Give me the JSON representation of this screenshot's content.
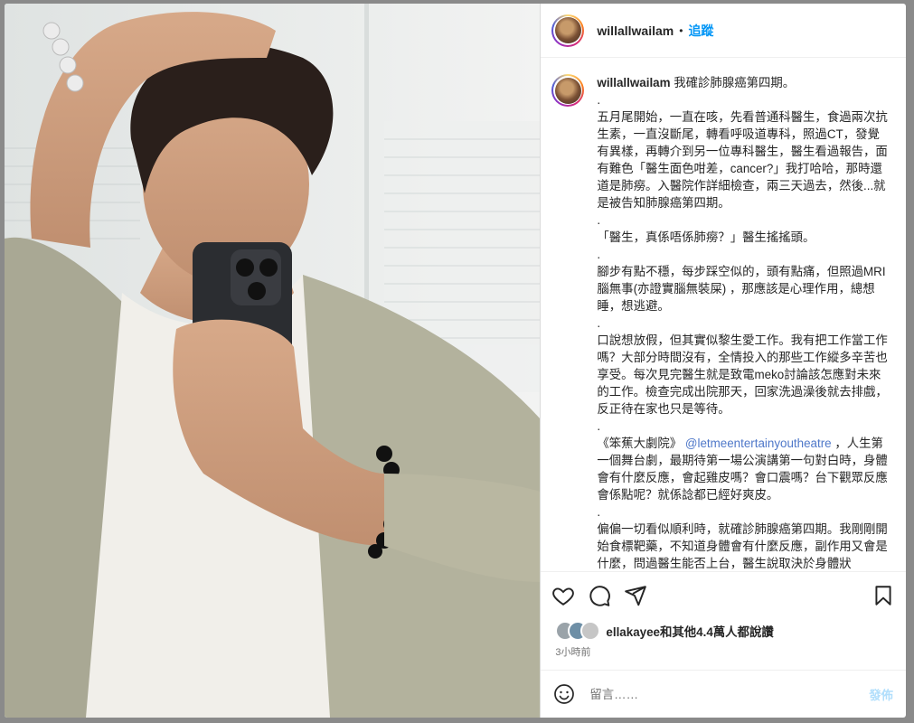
{
  "post": {
    "username": "willallwailam",
    "follow_label": "追蹤",
    "separator": "•",
    "caption_title": "我確診肺腺癌第四期。",
    "caption_paragraphs": [
      ".",
      "五月尾開始，一直在咳，先看普通科醫生，食過兩次抗生素，一直沒斷尾，轉看呼吸道專科，照過CT，發覺有異樣，再轉介到另一位專科醫生，醫生看過報告，面有難色「醫生面色咁差，cancer?」我打哈哈，那時還道是肺癆。入醫院作詳細檢查，兩三天過去，然後...就是被告知肺腺癌第四期。",
      ".",
      "「醫生，真係唔係肺癆？」醫生搖搖頭。",
      ".",
      "腳步有點不穩，每步踩空似的，頭有點痛，但照過MRI腦無事(亦證實腦無裝屎) ，那應該是心理作用，總想睡，想逃避。",
      ".",
      "口說想放假，但其實似黎生愛工作。我有把工作當工作嗎？大部分時間沒有，全情投入的那些工作縱多辛苦也享受。每次見完醫生就是致電meko討論該怎應對未來的工作。檢查完成出院那天，回家洗過澡後就去排戲，反正待在家也只是等待。",
      ".",
      "《笨蕉大劇院》",
      ".",
      "偏偏一切看似順利時，就確診肺腺癌第四期。我剛剛開始食標靶藥，不知道身體會有什麼反應，副作用又會是什麼，問過醫生能否上台，醫生說取決於身體狀"
    ],
    "mention": "@letmeentertainyoutheatre",
    "mention_after": "，人生第一個舞台劇，最期待第一場公演講第一句對白時，身體會有什麼反應，會起雞皮嗎？會口震嗎？台下觀眾反應會係點呢？就係諗都已經好爽皮。",
    "likes_user": "ellakayee",
    "likes_rest": "和其他4.4萬人都說讚",
    "time_ago": "3小時前",
    "comment_placeholder": "留言……",
    "post_label": "發佈"
  },
  "colors": {
    "accent": "#0095f6",
    "text": "#262626",
    "muted": "#737373",
    "post_disabled": "#b2dffc"
  }
}
